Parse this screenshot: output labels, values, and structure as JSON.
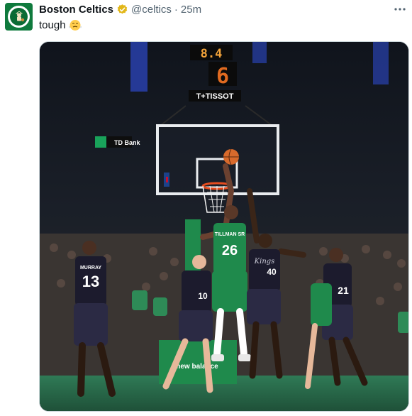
{
  "account": {
    "display_name": "Boston Celtics",
    "handle": "@celtics",
    "separator": "·",
    "time": "25m",
    "verified": true,
    "avatar_icon": "celtics-logo-icon",
    "brand_color": "#0f7a3d"
  },
  "tweet": {
    "text": "tough",
    "emoji_icon": "steaming-face-emoji-icon"
  },
  "media": {
    "shot_clock": "8.4",
    "shot_clock_seconds": "6",
    "sponsor_tissot": "T+TISSOT",
    "sponsor_td": "TD Bank",
    "courtside_brand": "new balance",
    "jerseys": {
      "celtics_player": "26",
      "celtics_name": "TILLMAN SR",
      "kings_player_a": "13",
      "kings_player_a_name": "MURRAY",
      "kings_player_b": "10",
      "kings_player_c": "40",
      "kings_player_c_script": "Kings",
      "kings_player_d": "21"
    }
  }
}
